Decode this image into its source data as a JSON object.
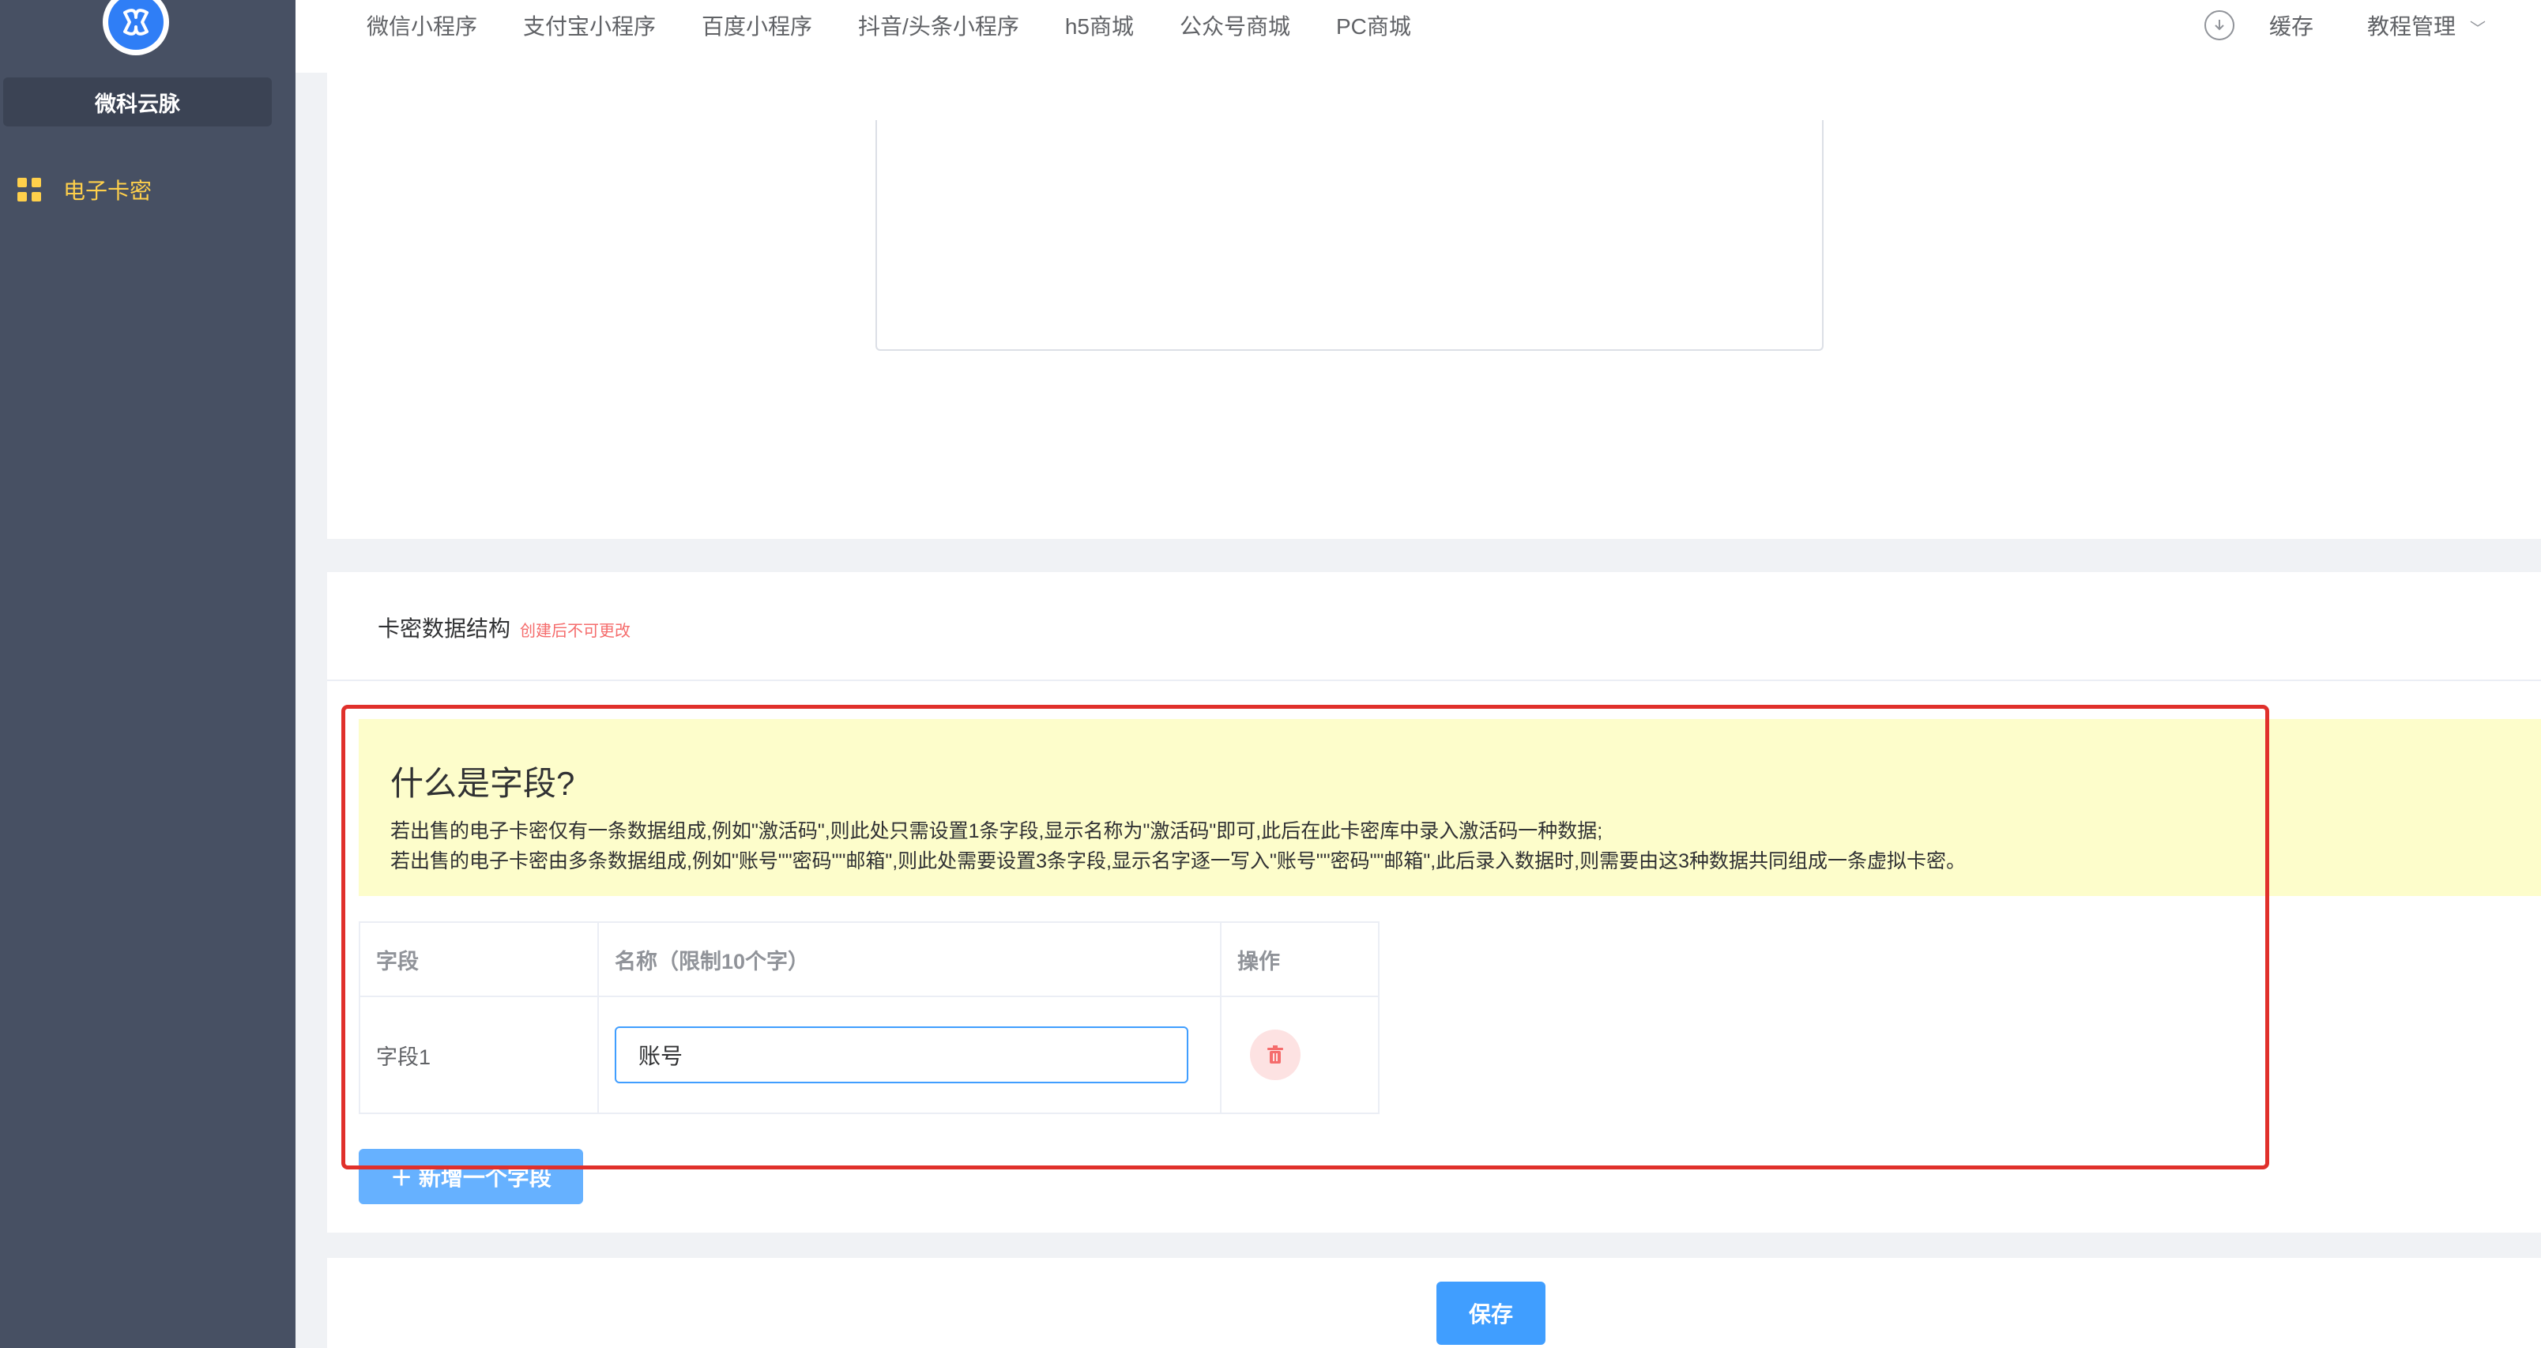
{
  "sidebar": {
    "brand": "微科云脉",
    "menu": [
      {
        "label": "电子卡密",
        "icon": "grid-icon",
        "active": true
      }
    ]
  },
  "topnav": {
    "links": [
      "微信小程序",
      "支付宝小程序",
      "百度小程序",
      "抖音/头条小程序",
      "h5商城",
      "公众号商城",
      "PC商城"
    ],
    "cache": "缓存",
    "tutorial": "教程管理"
  },
  "section": {
    "title": "卡密数据结构",
    "note": "创建后不可更改"
  },
  "info": {
    "title": "什么是字段?",
    "line1": "若出售的电子卡密仅有一条数据组成,例如\"激活码\",则此处只需设置1条字段,显示名称为\"激活码\"即可,此后在此卡密库中录入激活码一种数据;",
    "line2": "若出售的电子卡密由多条数据组成,例如\"账号\"\"密码\"\"邮箱\",则此处需要设置3条字段,显示名字逐一写入\"账号\"\"密码\"\"邮箱\",此后录入数据时,则需要由这3种数据共同组成一条虚拟卡密。"
  },
  "table": {
    "headers": [
      "字段",
      "名称（限制10个字）",
      "操作"
    ],
    "rows": [
      {
        "field": "字段1",
        "name": "账号"
      }
    ]
  },
  "buttons": {
    "add_field": "＋ 新增一个字段",
    "save": "保存"
  },
  "colors": {
    "sidebar": "#475063",
    "accent_yellow": "#ffd04b",
    "primary": "#409eff",
    "danger_outline": "#e0302b",
    "info_bg": "#fdfdcb"
  }
}
